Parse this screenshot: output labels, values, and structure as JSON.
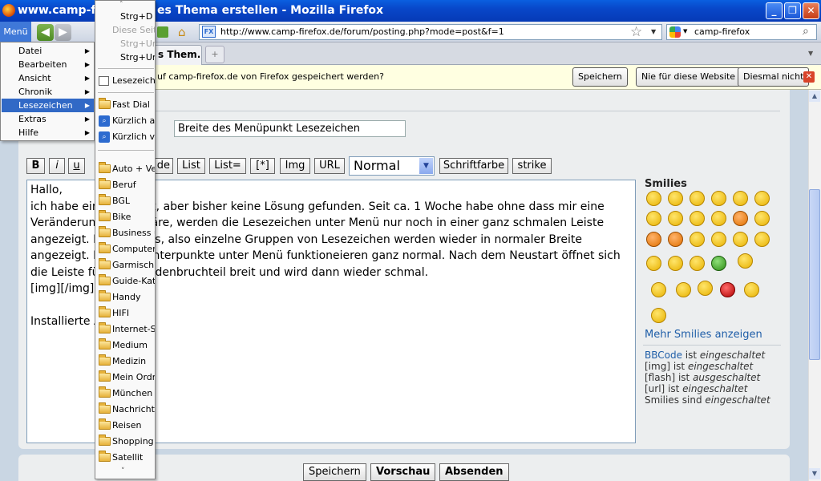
{
  "window": {
    "title": "www.camp-firefox.de • Neues Thema erstellen - Mozilla Firefox",
    "visible_title_left": "www.camp-fire",
    "visible_title_right": "es Thema erstellen - Mozilla Firefox",
    "controls": [
      "_",
      "❐",
      "✕"
    ]
  },
  "nav": {
    "menu_label": "Menü",
    "back": "◀",
    "forward": "▶",
    "url": "http://www.camp-firefox.de/forum/posting.php?mode=post&f=1",
    "url_icon": "FX",
    "search_value": "camp-firefox",
    "search_icon": "magnifier-icon"
  },
  "tabs": {
    "active_label": "s Them...",
    "new_tab": "+"
  },
  "notification": {
    "text": "uf camp-firefox.de von Firefox gespeichert werden?",
    "buttons": [
      "Speichern",
      "Nie für diese Website",
      "Diesmal nicht"
    ],
    "close": "✕"
  },
  "form": {
    "subject": "Breite des Menüpunkt Lesezeichen",
    "bbcode_buttons": [
      "B",
      "i",
      "u",
      "de",
      "List",
      "List=",
      "[*]",
      "Img",
      "URL",
      "Schriftfarbe",
      "strike"
    ],
    "font_size": "Normal",
    "message": "Hallo,\nich habe ein         ucht, aber bisher keine Lösung gefunden. Seit ca. 1 Woche habe ohne dass mir eine\nVeränderun          n wäre, werden die Lesezeichen unter Menü nur noch in einer ganz schmalen Leiste\nangezeigt. D         enüs, also einzelne Gruppen von Lesezeichen werden wieder in normaler Breite\nangezeigt. D         n Unterpunkte unter Menü funktioneieren ganz normal. Nach dem Neustart öffnet sich\ndie Leiste fü          kundenbruchteil breit und wird dann wieder schmal.\n[img][/img]\n\nInstallierte A",
    "submit_buttons": [
      "Speichern",
      "Vorschau",
      "Absenden"
    ]
  },
  "smilies": {
    "title": "Smilies",
    "more_link": "Mehr Smilies anzeigen",
    "info": [
      {
        "key": "BBCode",
        "text": " ist ",
        "state": "eingeschaltet"
      },
      {
        "key": "[img]",
        "text": " ist ",
        "state": "eingeschaltet"
      },
      {
        "key": "[flash]",
        "text": " ist ",
        "state": "ausgeschaltet"
      },
      {
        "key": "[url]",
        "text": " ist ",
        "state": "eingeschaltet"
      },
      {
        "key": "Smilies",
        "text": " sind ",
        "state": "eingeschaltet"
      }
    ]
  },
  "main_menu": {
    "items": [
      {
        "label": "Datei",
        "submenu": true
      },
      {
        "label": "Bearbeiten",
        "submenu": true
      },
      {
        "label": "Ansicht",
        "submenu": true
      },
      {
        "label": "Chronik",
        "submenu": true
      },
      {
        "label": "Lesezeichen",
        "submenu": true,
        "selected": true
      },
      {
        "label": "Extras",
        "submenu": true
      },
      {
        "label": "Hilfe",
        "submenu": true
      }
    ]
  },
  "bookmarks_menu": {
    "scroll_up": "˄",
    "scroll_down": "˅",
    "commands": [
      "Strg+D",
      "Diese Seite",
      "Strg+Um",
      "Strg+Um"
    ],
    "sidebar_item": "Lesezeiche",
    "special": [
      "Fast Dial",
      "Kürzlich als",
      "Kürzlich ve"
    ],
    "folders": [
      "Auto + Ver",
      "Beruf",
      "BGL",
      "Bike",
      "Business u",
      "Computer",
      "Garmisch",
      "Guide-Kate",
      "Handy",
      "HIFI",
      "Internet-Se",
      "Medium",
      "Medizin",
      "Mein Ordne",
      "München",
      "Nachrichte",
      "Reisen",
      "Shopping",
      "Satellit"
    ]
  },
  "colors": {
    "titlebar": "#0847c9",
    "menu_highlight": "#3169c6",
    "link": "#1f5ea8",
    "notification_bg": "#ffffe1"
  }
}
